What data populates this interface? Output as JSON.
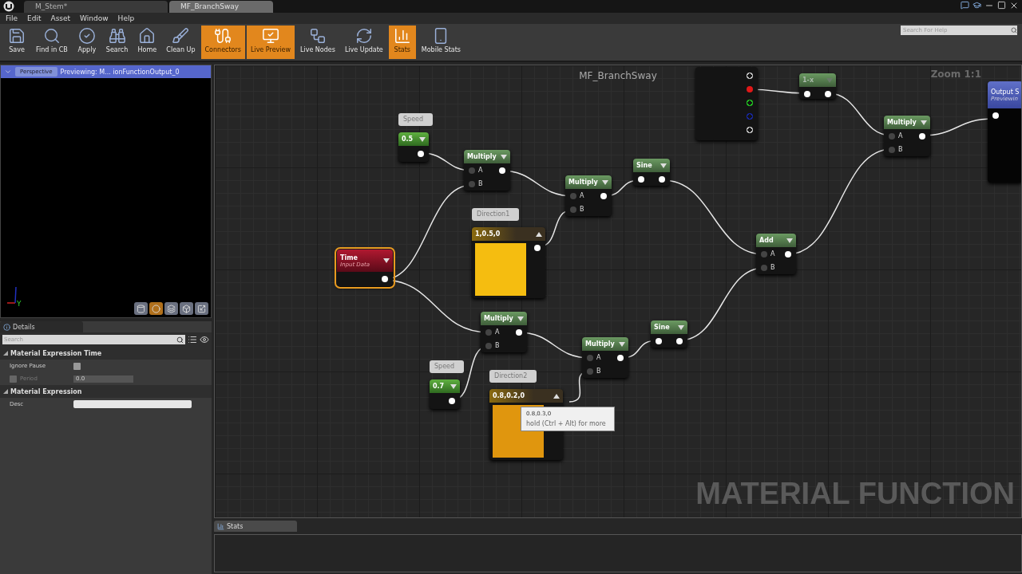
{
  "window": {
    "tabs": [
      {
        "label": "M_Stem*",
        "selected": false
      },
      {
        "label": "MF_BranchSway",
        "selected": true
      }
    ],
    "help_search": {
      "placeholder": "Search For Help"
    }
  },
  "menu": [
    "File",
    "Edit",
    "Asset",
    "Window",
    "Help"
  ],
  "toolbar": [
    {
      "kind": "save",
      "label": "Save",
      "on": false
    },
    {
      "kind": "find",
      "label": "Find in CB",
      "on": false
    },
    {
      "kind": "apply",
      "label": "Apply",
      "on": false
    },
    {
      "kind": "search",
      "label": "Search",
      "on": false
    },
    {
      "kind": "home",
      "label": "Home",
      "on": false
    },
    {
      "kind": "clean",
      "label": "Clean Up",
      "on": false
    },
    {
      "kind": "connectors",
      "label": "Connectors",
      "on": true
    },
    {
      "kind": "preview",
      "label": "Live Preview",
      "on": true
    },
    {
      "kind": "nodes",
      "label": "Live Nodes",
      "on": false
    },
    {
      "kind": "update",
      "label": "Live Update",
      "on": false
    },
    {
      "kind": "stats",
      "label": "Stats",
      "on": true
    },
    {
      "kind": "mobile",
      "label": "Mobile Stats",
      "on": false
    }
  ],
  "viewport": {
    "view_button": "Perspective",
    "caption": "Previewing: M... ionFunctionOutput_0",
    "axis_label": "Y"
  },
  "details": {
    "tab": "Details",
    "search": {
      "placeholder": "Search"
    },
    "sections": [
      {
        "title": "Material Expression Time",
        "expanded": true,
        "rows": [
          {
            "kind": "checkbox",
            "label": "Ignore Pause",
            "checked": false,
            "disabled": false
          },
          {
            "kind": "number",
            "label": "Period",
            "checked": false,
            "disabled": true,
            "value": "0.0"
          }
        ]
      },
      {
        "title": "Material Expression",
        "expanded": true,
        "rows": [
          {
            "kind": "text",
            "label": "Desc",
            "disabled": false
          }
        ]
      }
    ]
  },
  "graph": {
    "title": "MF_BranchSway",
    "zoom": "Zoom 1:1",
    "watermark": "MATERIAL FUNCTION",
    "nodes": [
      {
        "kind": "mask",
        "selected": false,
        "outputs": [
          {
            "color": "#d0d0d0",
            "connected": false
          },
          {
            "color": "#e01818",
            "connected": true
          },
          {
            "color": "#22d022",
            "connected": false
          },
          {
            "color": "#1828a8",
            "connected": false
          },
          {
            "color": "#d0d0d0",
            "connected": false
          }
        ]
      },
      {
        "kind": "unary",
        "title": "1-x",
        "selected": false,
        "dimmed": true
      },
      {
        "kind": "constant",
        "title": "0.5",
        "comment": "Speed",
        "selected": false,
        "dimmed": false
      },
      {
        "kind": "math",
        "title": "Multiply",
        "inputs": [
          "A",
          "B"
        ],
        "selected": false,
        "dimmed": false
      },
      {
        "kind": "math",
        "title": "Multiply",
        "inputs": [
          "A",
          "B"
        ],
        "selected": false,
        "dimmed": false
      },
      {
        "kind": "unary",
        "title": "Sine",
        "selected": false,
        "dimmed": false
      },
      {
        "kind": "math",
        "title": "Multiply",
        "inputs": [
          "A",
          "B"
        ],
        "selected": false,
        "dimmed": false
      },
      {
        "kind": "output",
        "title": "Output S",
        "subtitle": "Previewin",
        "selected": false,
        "dimmed": false
      },
      {
        "kind": "input",
        "title": "Time",
        "subtitle": "Input Data",
        "selected": true,
        "dimmed": false
      },
      {
        "kind": "vector",
        "title": "1,0.5,0",
        "comment": "Direction1",
        "color": "#f5bd10",
        "selected": false,
        "dimmed": false
      },
      {
        "kind": "math",
        "title": "Add",
        "inputs": [
          "A",
          "B"
        ],
        "selected": false,
        "dimmed": false
      },
      {
        "kind": "math",
        "title": "Multiply",
        "inputs": [
          "A",
          "B"
        ],
        "selected": false,
        "dimmed": false
      },
      {
        "kind": "math",
        "title": "Multiply",
        "inputs": [
          "A",
          "B"
        ],
        "selected": false,
        "dimmed": false
      },
      {
        "kind": "unary",
        "title": "Sine",
        "selected": false,
        "dimmed": false
      },
      {
        "kind": "constant",
        "title": "0.7",
        "comment": "Speed",
        "selected": false,
        "dimmed": false
      },
      {
        "kind": "vector",
        "title": "0.8,0.2,0",
        "comment": "Direction2",
        "color": "#e0960e",
        "selected": false,
        "dimmed": false
      }
    ],
    "tooltip": {
      "title": "0.8,0.3,0",
      "hint": "hold (Ctrl + Alt) for more"
    }
  },
  "stats": {
    "tab": "Stats"
  }
}
